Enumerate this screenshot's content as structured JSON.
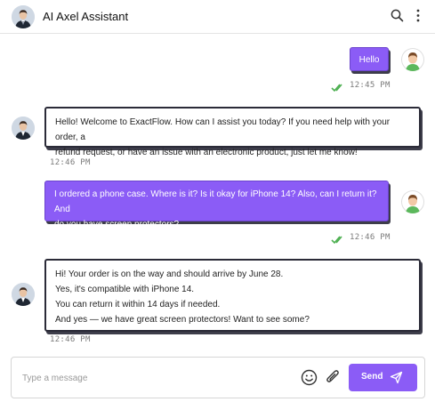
{
  "header": {
    "title": "AI Axel Assistant",
    "icons": [
      "search-icon",
      "more-vertical-icon"
    ]
  },
  "messages": [
    {
      "sender": "user",
      "text": "Hello",
      "time": "12:45 PM",
      "status": "read"
    },
    {
      "sender": "bot",
      "lines": [
        "Hello! Welcome to ExactFlow. How can I assist you today? If you need help with your order, a",
        "refund request, or have an issue with an electronic product, just let me know!"
      ],
      "time": "12:46 PM"
    },
    {
      "sender": "user",
      "lines": [
        "I ordered a phone case. Where is it? Is it okay for iPhone 14? Also, can I return it? And",
        "do you have screen protectors?"
      ],
      "time": "12:46 PM",
      "status": "read"
    },
    {
      "sender": "bot",
      "lines": [
        "Hi! Your order is on the way and should arrive by June 28.",
        "Yes, it's compatible with iPhone 14.",
        "You can return it within 14 days if needed.",
        "And yes — we have great screen protectors! Want to see some?"
      ],
      "time": "12:46 PM"
    }
  ],
  "composer": {
    "placeholder": "Type a message",
    "value": "",
    "send_label": "Send",
    "icons": [
      "emoji-icon",
      "attachment-icon",
      "send-icon"
    ]
  },
  "colors": {
    "accent": "#8b5cf6",
    "bubble_border": "#2b2b38",
    "read_check": "#4caf50"
  }
}
